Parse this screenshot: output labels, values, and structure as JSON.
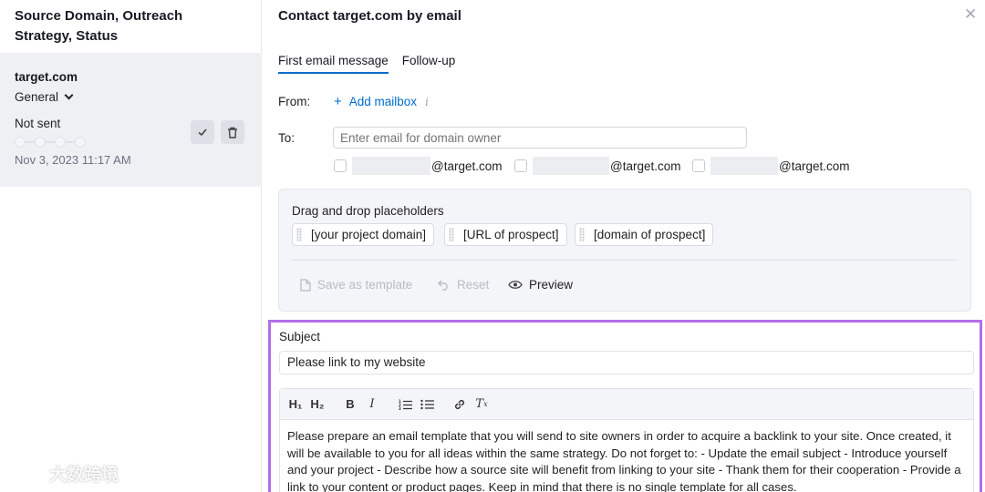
{
  "left": {
    "header": "Source Domain, Outreach Strategy, Status",
    "card": {
      "domain": "target.com",
      "category": "General",
      "status": "Not sent",
      "date": "Nov 3, 2023 11:17 AM",
      "progress_steps": 4,
      "progress_done": 0
    }
  },
  "modal": {
    "title": "Contact target.com by email",
    "tabs": [
      {
        "label": "First email message",
        "active": true
      },
      {
        "label": "Follow-up",
        "active": false
      }
    ],
    "from_label": "From:",
    "add_mailbox": "Add mailbox",
    "to_label": "To:",
    "to_placeholder": "Enter email for domain owner",
    "addresses": [
      "@target.com",
      "@target.com",
      "@target.com"
    ],
    "placeholders": {
      "title": "Drag and drop placeholders",
      "chips": [
        "[your project domain]",
        "[URL of prospect]",
        "[domain of prospect]"
      ],
      "save_template": "Save as template",
      "reset": "Reset",
      "preview": "Preview"
    },
    "subject_label": "Subject",
    "subject_value": "Please link to my website",
    "body": "Please prepare an email template that you will send to site owners in order to acquire a backlink to your site. Once created, it will be available to you for all ideas within the same strategy. Do not forget to: - Update the email subject - Introduce yourself and your project - Describe how a source site will benefit from linking to your site - Thank them for their cooperation - Provide a link to your content or product pages. Keep in mind that there is no single template for all cases."
  },
  "watermark": "大数跨境",
  "colors": {
    "accent": "#006dca",
    "highlight_border": "#b46ee6"
  }
}
